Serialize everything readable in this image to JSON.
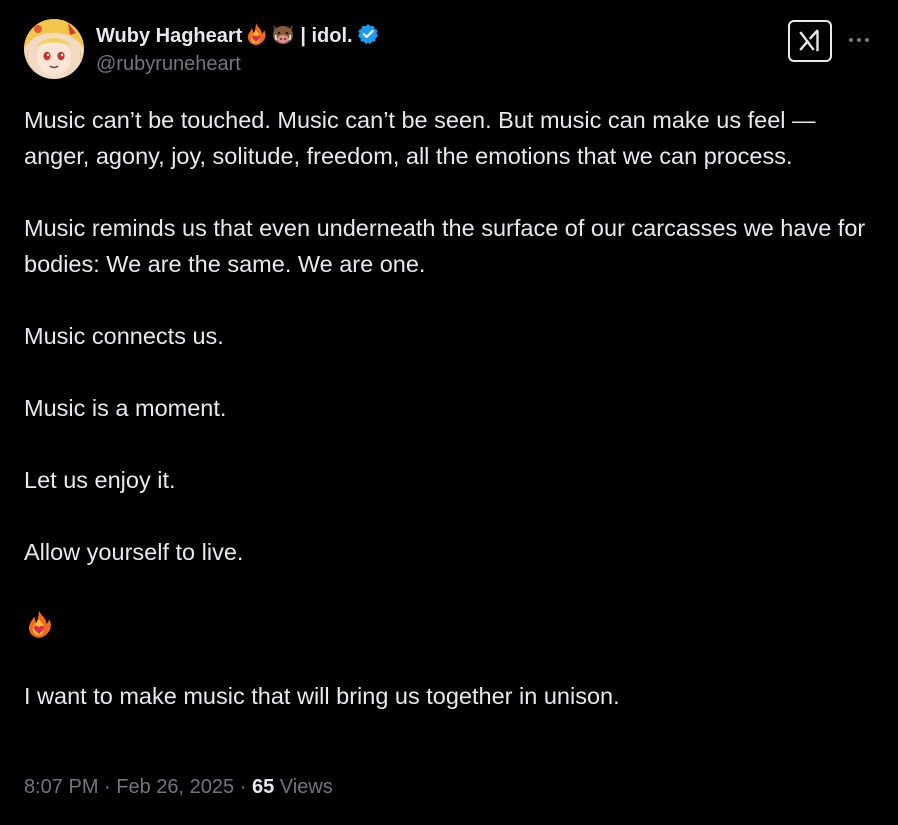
{
  "author": {
    "display_name": "Wuby Hagheart",
    "name_emojis": [
      "fire-heart-emoji",
      "boar-emoji"
    ],
    "name_suffix": "| idol.",
    "handle": "@rubyruneheart",
    "verified": true
  },
  "icons": {
    "header_right": [
      "xai-logo-icon",
      "more-options-icon"
    ]
  },
  "tweet": {
    "paragraphs": [
      "Music can’t be touched. Music can’t be seen. But music can make us feel — anger, agony, joy, solitude, freedom, all the emotions that we can process.",
      "Music reminds us that even underneath the surface of our carcasses we have for bodies: We are the same. We are one.",
      "Music connects us.",
      "Music is a moment.",
      "Let us enjoy it.",
      "Allow yourself to live."
    ],
    "emoji_line": "fire-heart-emoji",
    "closing": "I want to make music that will bring us together in unison."
  },
  "meta": {
    "time": "8:07 PM",
    "separator": "·",
    "date": "Feb 26, 2025",
    "views_count": "65",
    "views_label": "Views"
  },
  "colors": {
    "background": "#000000",
    "text_primary": "#e7e9ea",
    "text_secondary": "#71767b",
    "verified_blue": "#1d9bf0"
  }
}
